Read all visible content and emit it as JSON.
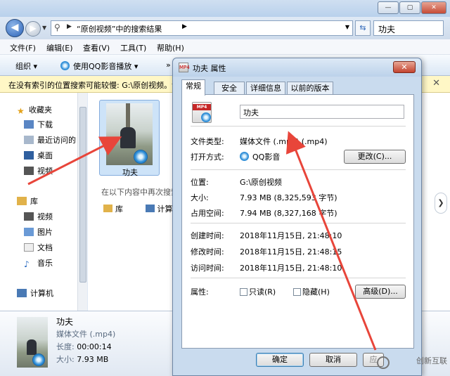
{
  "window": {
    "min_label": "—",
    "max_label": "▢",
    "close_label": "✕"
  },
  "address": {
    "path": "“原创视频”中的搜索结果",
    "search_value": "功夫"
  },
  "menu": [
    "文件(F)",
    "编辑(E)",
    "查看(V)",
    "工具(T)",
    "帮助(H)"
  ],
  "toolbar": {
    "organize": "组织 ▾",
    "play_with": "使用QQ影音播放 ▾",
    "overflow": "»"
  },
  "infobar": {
    "text": "在没有索引的位置搜索可能较慢: G:\\原创视频。请",
    "close": "✕"
  },
  "nav": {
    "favorites": "收藏夹",
    "downloads": "下载",
    "recent": "最近访问的",
    "desktop": "桌面",
    "videos_fav": "视频",
    "libraries": "库",
    "lib_videos": "视频",
    "lib_pictures": "图片",
    "lib_documents": "文档",
    "lib_music": "音乐",
    "computer": "计算机"
  },
  "content": {
    "file_name": "功夫",
    "search_again": "在以下内容中再次搜索:",
    "link_libraries": "库",
    "link_computer": "计算机"
  },
  "details": {
    "name": "功夫",
    "type": "媒体文件 (.mp4)",
    "length_key": "长度:",
    "length_val": "00:00:14",
    "size_key": "大小:",
    "size_val": "7.93 MB"
  },
  "dialog": {
    "title": "功夫 属性",
    "close": "✕",
    "tabs": [
      "常规",
      "安全",
      "详细信息",
      "以前的版本"
    ],
    "name_value": "功夫",
    "file_type_label": "文件类型:",
    "file_type_value": "媒体文件 (.mp4) (.mp4)",
    "opens_with_label": "打开方式:",
    "opens_with_value": "QQ影音",
    "change_button": "更改(C)...",
    "location_label": "位置:",
    "location_value": "G:\\原创视频",
    "size_label": "大小:",
    "size_value": "7.93 MB (8,325,593 字节)",
    "size_on_disk_label": "占用空间:",
    "size_on_disk_value": "7.94 MB (8,327,168 字节)",
    "created_label": "创建时间:",
    "created_value": "2018年11月15日, 21:48:10",
    "modified_label": "修改时间:",
    "modified_value": "2018年11月15日, 21:48:15",
    "accessed_label": "访问时间:",
    "accessed_value": "2018年11月15日, 21:48:10",
    "attributes_label": "属性:",
    "readonly_label": "只读(R)",
    "hidden_label": "隐藏(H)",
    "advanced_button": "高级(D)...",
    "ok_button": "确定",
    "cancel_button": "取消",
    "apply_button": "应"
  },
  "watermark": "创新互联",
  "colors": {
    "annotation_arrow": "#e8453a",
    "selection": "#cde3f8"
  }
}
